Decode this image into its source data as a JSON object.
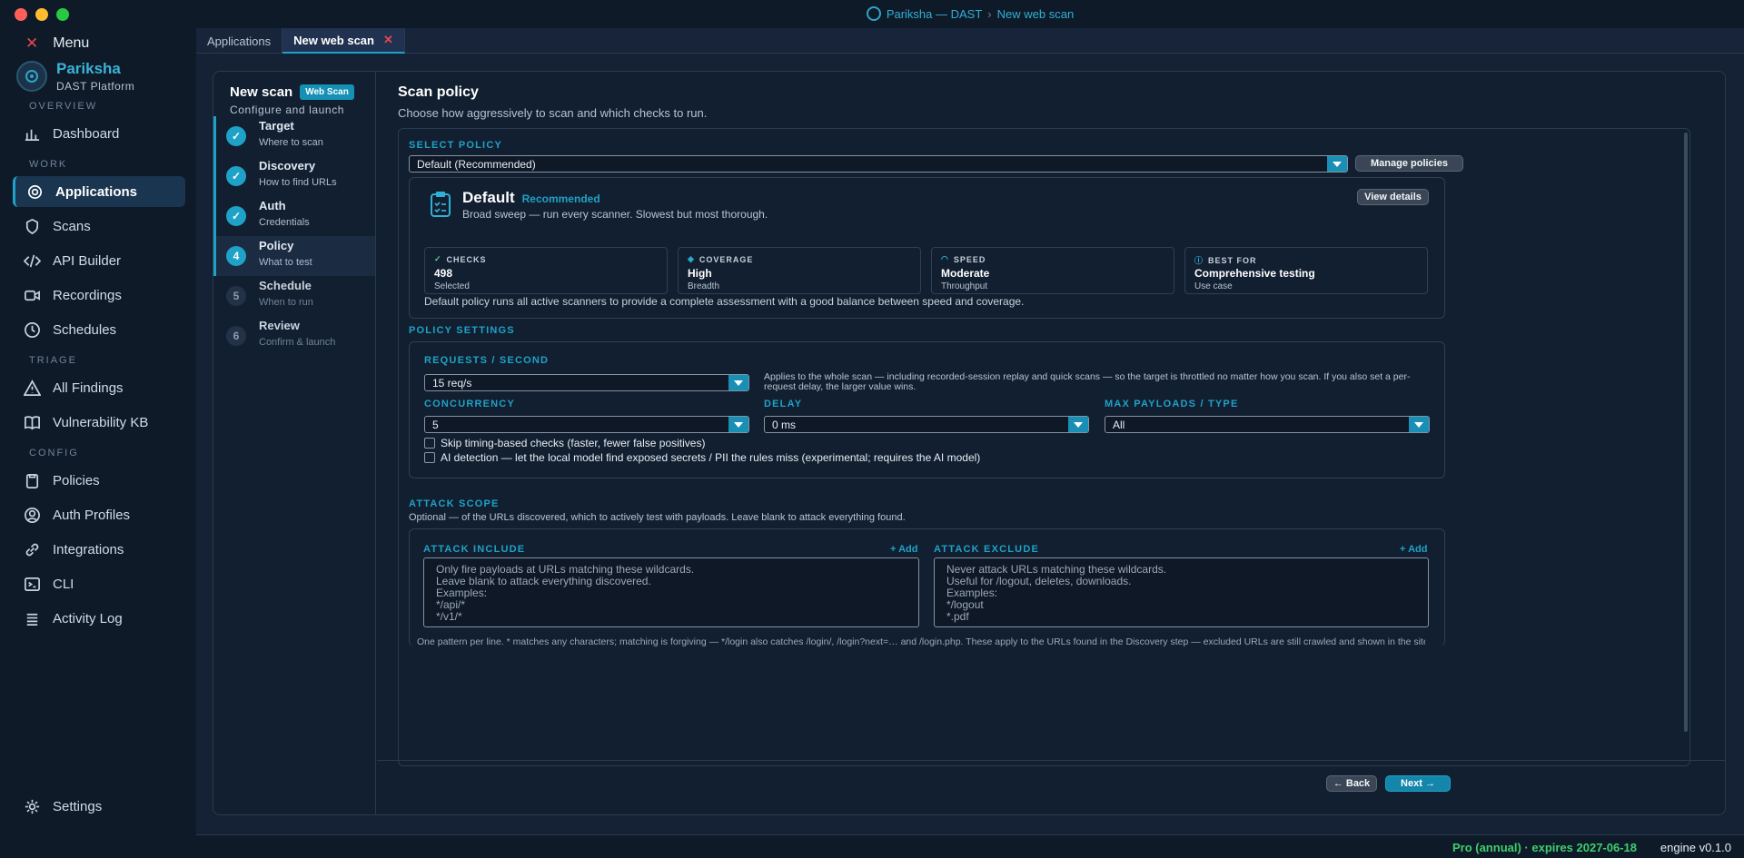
{
  "window": {
    "title_app": "Pariksha — DAST",
    "title_sep": "›",
    "title_page": "New web scan"
  },
  "sidebar": {
    "menu_label": "Menu",
    "brand_name": "Pariksha",
    "brand_sub": "DAST Platform",
    "sections": {
      "overview": "OVERVIEW",
      "work": "WORK",
      "triage": "TRIAGE",
      "config": "CONFIG"
    },
    "items": {
      "dashboard": "Dashboard",
      "applications": "Applications",
      "scans": "Scans",
      "api_builder": "API Builder",
      "recordings": "Recordings",
      "schedules": "Schedules",
      "all_findings": "All Findings",
      "vuln_kb": "Vulnerability KB",
      "policies": "Policies",
      "auth_profiles": "Auth Profiles",
      "integrations": "Integrations",
      "cli": "CLI",
      "activity_log": "Activity Log",
      "settings": "Settings"
    }
  },
  "tabs": [
    {
      "label": "Applications"
    },
    {
      "label": "New web scan",
      "close": "✕"
    }
  ],
  "wizard": {
    "title": "New scan",
    "badge": "Web Scan",
    "subtitle": "Configure and launch",
    "steps": [
      {
        "name": "Target",
        "desc": "Where to scan",
        "state": "done"
      },
      {
        "name": "Discovery",
        "desc": "How to find URLs",
        "state": "done"
      },
      {
        "name": "Auth",
        "desc": "Credentials",
        "state": "done"
      },
      {
        "name": "Policy",
        "desc": "What to test",
        "state": "current",
        "num": "4"
      },
      {
        "name": "Schedule",
        "desc": "When to run",
        "state": "todo",
        "num": "5"
      },
      {
        "name": "Review",
        "desc": "Confirm & launch",
        "state": "todo",
        "num": "6"
      }
    ]
  },
  "policy": {
    "heading": "Scan policy",
    "subheading": "Choose how aggressively to scan and which checks to run.",
    "select_label": "SELECT POLICY",
    "selected": "Default (Recommended)",
    "manage_button": "Manage policies",
    "card": {
      "name": "Default",
      "tag": "Recommended",
      "desc": "Broad sweep — run every scanner. Slowest but most thorough.",
      "view_button": "View details",
      "stats": [
        {
          "label": "CHECKS",
          "value": "498",
          "desc": "Selected",
          "icon": "check-icon"
        },
        {
          "label": "COVERAGE",
          "value": "High",
          "desc": "Breadth",
          "icon": "coverage-icon"
        },
        {
          "label": "SPEED",
          "value": "Moderate",
          "desc": "Throughput",
          "icon": "speed-icon"
        },
        {
          "label": "BEST FOR",
          "value": "Comprehensive testing",
          "desc": "Use case",
          "icon": "info-icon"
        }
      ],
      "summary": "Default policy runs all active scanners to provide a complete assessment with a good balance between speed and coverage."
    },
    "settings_label": "POLICY SETTINGS",
    "rps_label": "REQUESTS / SECOND",
    "rps_value": "15 req/s",
    "rps_note": "Applies to the whole scan — including recorded-session replay and quick scans — so the target is throttled no matter how you scan. If you also set a per-request delay, the larger value wins.",
    "concurrency_label": "CONCURRENCY",
    "concurrency_value": "5",
    "delay_label": "DELAY",
    "delay_value": "0 ms",
    "max_payloads_label": "MAX PAYLOADS / TYPE",
    "max_payloads_value": "All",
    "skip_timing": "Skip timing-based checks (faster, fewer false positives)",
    "ai_detection": "AI detection — let the local model find exposed secrets / PII the rules miss (experimental; requires the AI model)"
  },
  "scope": {
    "label": "ATTACK SCOPE",
    "desc": "Optional — of the URLs discovered, which to actively test with payloads. Leave blank to attack everything found.",
    "include_label": "ATTACK INCLUDE",
    "exclude_label": "ATTACK EXCLUDE",
    "add": "+ Add",
    "include_placeholder": "Only fire payloads at URLs matching these wildcards.\nLeave blank to attack everything discovered.\nExamples:\n*/api/*\n*/v1/*",
    "exclude_placeholder": "Never attack URLs matching these wildcards.\nUseful for /logout, deletes, downloads.\nExamples:\n*/logout\n*.pdf",
    "footnote": "One pattern per line. * matches any characters; matching is forgiving — */login also catches /login/, /login?next=… and /login.php. These apply to the URLs found in the Discovery step — excluded URLs are still crawled and shown in the sitemap, just not"
  },
  "footer": {
    "back": "← Back",
    "next": "Next →"
  },
  "status": {
    "license": "Pro (annual) · expires 2027-06-18",
    "engine": "engine v0.1.0"
  },
  "colors": {
    "accent": "#1fa2c7",
    "license_green": "#3ecf6e",
    "close_red": "#e5484d"
  }
}
